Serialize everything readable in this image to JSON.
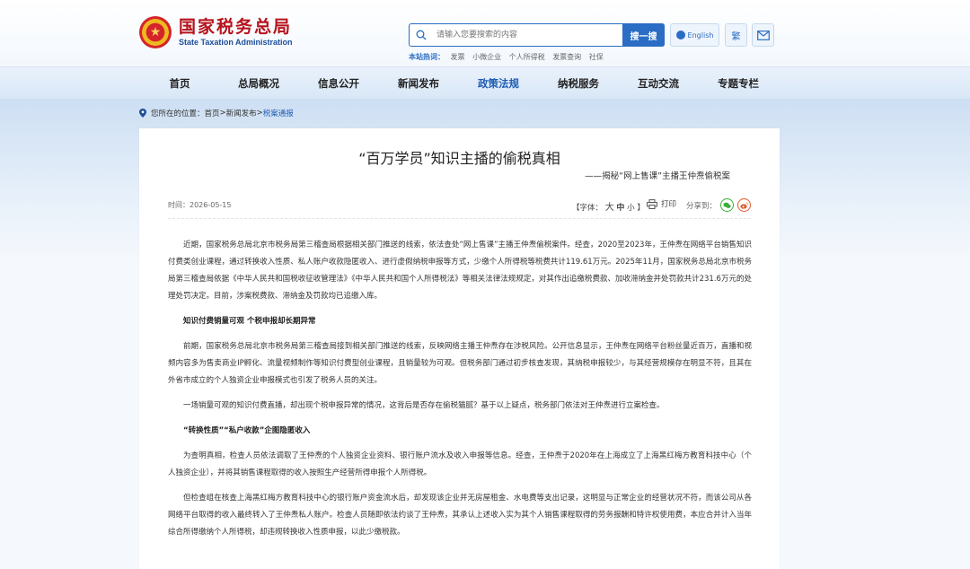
{
  "header": {
    "logo_cn": "国家税务总局",
    "logo_en": "State Taxation Administration",
    "search_placeholder": "请输入您要搜索的内容",
    "search_button": "搜一搜",
    "english_label": "English",
    "traditional_label": "繁",
    "hot_label": "本站热词：",
    "hot_words": [
      "发票",
      "小微企业",
      "个人所得税",
      "发票查询",
      "社保"
    ],
    "accent_color": "#2b6cc4",
    "brand_red": "#b5121b"
  },
  "nav": {
    "items": [
      "首页",
      "总局概况",
      "信息公开",
      "新闻发布",
      "政策法规",
      "纳税服务",
      "互动交流",
      "专题专栏"
    ],
    "active": "政策法规"
  },
  "breadcrumb": {
    "prefix": "您所在的位置：",
    "home": "首页",
    "news": "新闻发布",
    "current": "税案通报",
    "sep": ">"
  },
  "article": {
    "title": "“百万学员”知识主播的偷税真相",
    "subtitle": "——揭秘“网上售课”主播王仲焘偷税案",
    "date": "时间：2026-05-15",
    "font_label": "【字体：",
    "font_big": "大",
    "font_mid": "中",
    "font_small": "小",
    "font_close": "】",
    "print_label": "打印",
    "share_label": "分享到：",
    "paragraphs": [
      "近期，国家税务总局北京市税务局第三稽查局根据相关部门推送的线索，依法查处“网上售课”主播王仲焘偷税案件。经查，2020至2023年，王仲焘在网络平台销售知识付费类创业课程，通过转换收入性质、私人账户收款隐匿收入、进行虚假纳税申报等方式，少缴个人所得税等税费共计119.61万元。2025年11月，国家税务总局北京市税务局第三稽查局依据《中华人民共和国税收征收管理法》《中华人民共和国个人所得税法》等相关法律法规规定，对其作出追缴税费款、加收滞纳金并处罚款共计231.6万元的处理处罚决定。目前，涉案税费款、滞纳金及罚款均已追缴入库。",
      "知识付费销量可观 个税申报却长期异常",
      "前期，国家税务总局北京市税务局第三稽查局接到相关部门推送的线索，反映网络主播王仲焘存在涉税风险。公开信息显示，王仲焘在网络平台粉丝量近百万，直播和视频内容多为售卖商业IP孵化、流量视频制作等知识付费型创业课程，且销量较为可观。但税务部门通过初步核查发现，其纳税申报较少，与其经营规模存在明显不符，且其在外省市成立的个人独资企业申报模式也引发了税务人员的关注。",
      "一场销量可观的知识付费直播，却出现个税申报异常的情况，这背后是否存在偷税猫腻？基于以上疑点，税务部门依法对王仲焘进行立案检查。",
      "“转换性质”“私户收款”企图隐匿收入",
      "为查明真相，检查人员依法调取了王仲焘的个人独资企业资料、银行账户流水及收入申报等信息。经查，王仲焘于2020年在上海成立了上海黑红梅方教育科技中心（个人独资企业），并将其销售课程取得的收入按照生产经营所得申报个人所得税。",
      "但检查组在核查上海黑红梅方教育科技中心的银行账户资金流水后，却发现该企业并无房屋租金、水电费等支出记录，这明显与正常企业的经营状况不符，而该公司从各网络平台取得的收入最终转入了王仲焘私人账户。检查人员随即依法约谈了王仲焘，其承认上述收入实为其个人销售课程取得的劳务报酬和特许权使用费，本应合并计入当年综合所得缴纳个人所得税，却违规转换收入性质申报，以此少缴税款。"
    ]
  }
}
